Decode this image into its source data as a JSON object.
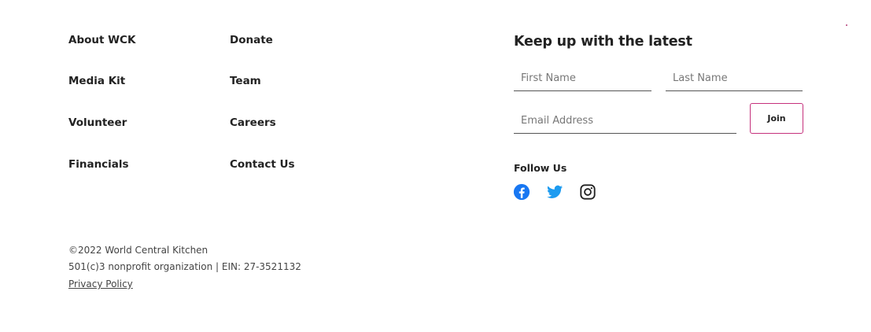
{
  "footer_nav": {
    "col1": [
      "About WCK",
      "Media Kit",
      "Volunteer",
      "Financials"
    ],
    "col2": [
      "Donate",
      "Team",
      "Careers",
      "Contact Us"
    ]
  },
  "signup": {
    "title": "Keep up with the latest",
    "first_name_placeholder": "First Name",
    "last_name_placeholder": "Last Name",
    "email_placeholder": "Email Address",
    "join_label": "Join"
  },
  "social": {
    "label": "Follow Us",
    "icons": [
      "facebook-icon",
      "twitter-icon",
      "instagram-icon"
    ]
  },
  "legal": {
    "copyright": "©2022 World Central Kitchen",
    "nonprofit": "501(c)3 nonprofit organization | EIN: 27-3521132",
    "privacy": "Privacy Policy"
  },
  "colors": {
    "text": "#222222",
    "accent": "#c5317c",
    "facebook": "#1877f2",
    "twitter": "#1d9bf0"
  }
}
